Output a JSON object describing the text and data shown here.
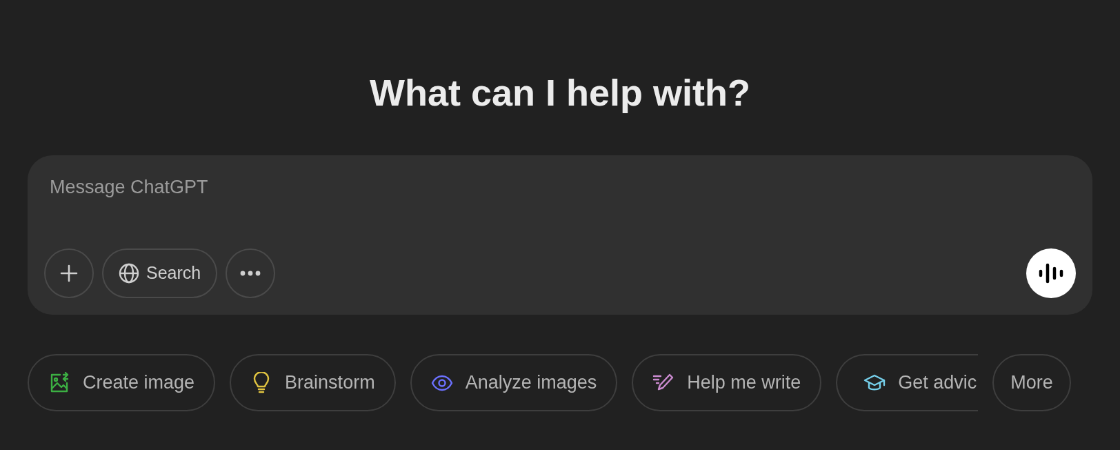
{
  "heading": "What can I help with?",
  "composer": {
    "placeholder": "Message ChatGPT",
    "tools": [
      {
        "kind": "plus"
      },
      {
        "kind": "search",
        "label": "Search"
      },
      {
        "kind": "more"
      }
    ]
  },
  "suggestions": [
    {
      "kind": "image",
      "label": "Create image",
      "color": "#3cb043",
      "cut": false
    },
    {
      "kind": "bulb",
      "label": "Brainstorm",
      "color": "#e2c541",
      "cut": false
    },
    {
      "kind": "eye",
      "label": "Analyze images",
      "color": "#6c71ff",
      "cut": false
    },
    {
      "kind": "pen",
      "label": "Help me write",
      "color": "#cb8bd0",
      "cut": false
    },
    {
      "kind": "cap",
      "label": "Get advic",
      "color": "#76d0eb",
      "cut": true
    },
    {
      "kind": "plain",
      "label": "More",
      "cut": false
    }
  ]
}
